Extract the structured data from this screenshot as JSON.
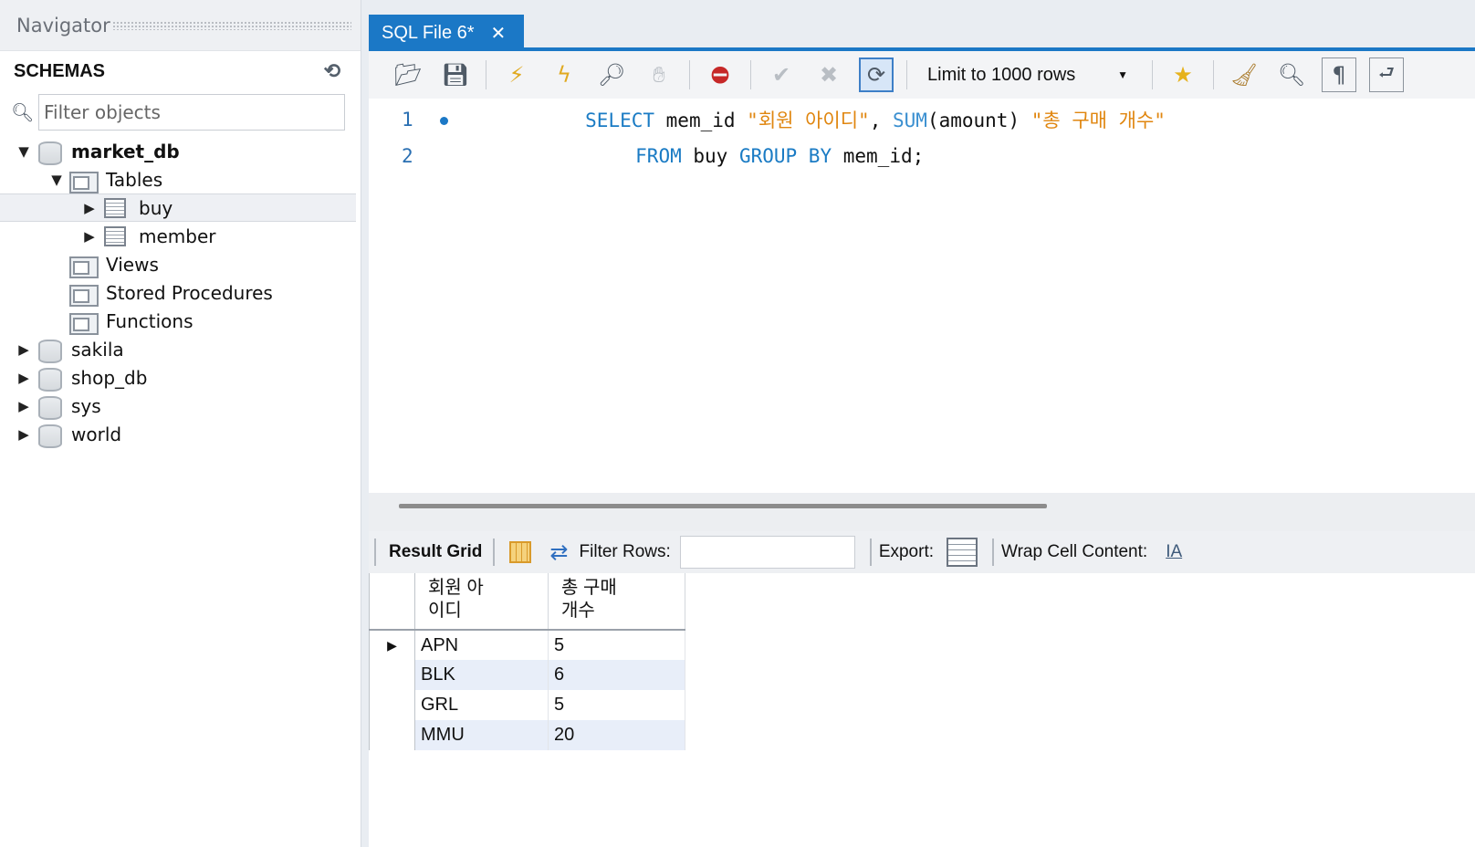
{
  "navigator": {
    "title": "Navigator",
    "schemas_label": "SCHEMAS",
    "filter_placeholder": "Filter objects",
    "tree": {
      "market_db": "market_db",
      "tables": "Tables",
      "buy": "buy",
      "member": "member",
      "views": "Views",
      "procedures": "Stored Procedures",
      "functions": "Functions",
      "sakila": "sakila",
      "shop_db": "shop_db",
      "sys": "sys",
      "world": "world"
    }
  },
  "tab": {
    "title": "SQL File 6*",
    "close": "✕"
  },
  "toolbar": {
    "limit": "Limit to 1000 rows"
  },
  "editor": {
    "line1_no": "1",
    "line2_no": "2",
    "line1": {
      "select": "SELECT",
      "col": " mem_id ",
      "alias1": "\"회원 아이디\"",
      "comma": ", ",
      "sum": "SUM",
      "args": "(amount) ",
      "alias2": "\"총 구매 개수\""
    },
    "line2": {
      "from": "FROM",
      "table": " buy ",
      "groupby": "GROUP BY",
      "col": " mem_id;"
    }
  },
  "result": {
    "grid_label": "Result Grid",
    "filter_label": "Filter Rows:",
    "export_label": "Export:",
    "wrap_label": "Wrap Cell Content:",
    "columns": [
      "회원 아\n이디",
      "총 구매\n개수"
    ],
    "col1_header": "회원 아\n이디",
    "col2_header": "총 구매\n개수",
    "rows": [
      {
        "id": "APN",
        "count": "5"
      },
      {
        "id": "BLK",
        "count": "6"
      },
      {
        "id": "GRL",
        "count": "5"
      },
      {
        "id": "MMU",
        "count": "20"
      }
    ]
  }
}
